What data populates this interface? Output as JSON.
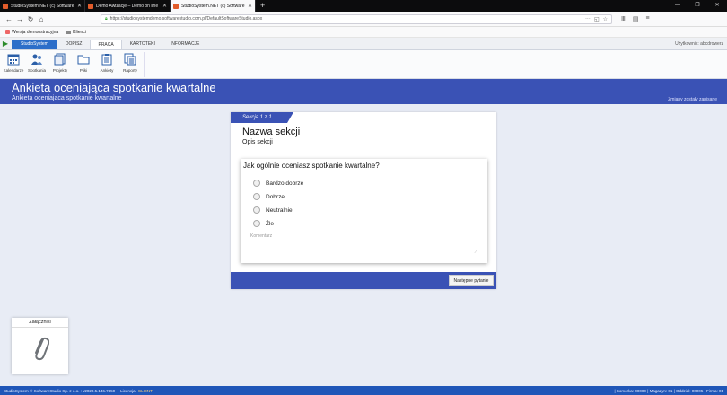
{
  "browser": {
    "tabs": [
      {
        "title": "StudioSystem.NET (c) Software",
        "color": "#e25c2b",
        "active": false
      },
      {
        "title": "Demo Awizacje – Demo on line",
        "color": "#e25c2b",
        "active": false
      },
      {
        "title": "StudioSystem.NET (c) Software",
        "color": "#e25c2b",
        "active": true
      }
    ],
    "new_tab": "+",
    "url": "https://studiosystemdemo.softwarestudio.com.pl/DefaultSoftwareStudio.aspx",
    "bookmarks": [
      {
        "label": "Wersja demonstracyjna",
        "type": "page"
      },
      {
        "label": "Klienci",
        "type": "folder"
      }
    ]
  },
  "app": {
    "tabs": [
      {
        "label": "StudioSystem",
        "kind": "brand"
      },
      {
        "label": "DOPISZ",
        "kind": "normal"
      },
      {
        "label": "PRACA",
        "kind": "active"
      },
      {
        "label": "KARTOTEKI",
        "kind": "normal"
      },
      {
        "label": "INFORMACJE",
        "kind": "normal"
      }
    ],
    "user": "Użytkownik: abcdrowerz",
    "tools": [
      {
        "label": "Kalendarze",
        "icon": "calendar-icon"
      },
      {
        "label": "Spotkania",
        "icon": "people-icon"
      },
      {
        "label": "Projekty",
        "icon": "projects-icon"
      },
      {
        "label": "Pliki",
        "icon": "folder-icon"
      },
      {
        "label": "Ankiety",
        "icon": "survey-icon"
      },
      {
        "label": "Raporty",
        "icon": "reports-icon"
      }
    ]
  },
  "banner": {
    "title": "Ankieta oceniająca spotkanie kwartalne",
    "subtitle": "Ankieta oceniająca spotkanie kwartalne",
    "saved": "Zmiany zostały zapisane"
  },
  "survey": {
    "section_tag": "Sekcja 1 z 1",
    "section_title": "Nazwa sekcji",
    "section_desc": "Opis sekcji",
    "question": "Jak ogólnie oceniasz spotkanie kwartalne?",
    "options": [
      "Bardzo dobrze",
      "Dobrze",
      "Neutralnie",
      "Źle"
    ],
    "comment_placeholder": "Komentarz",
    "next_button": "Następne pytanie"
  },
  "attachments": {
    "title": "Załączniki"
  },
  "status": {
    "left": "StudioSystem © SoftwareStudio Sp. z o.o. : v2020.5.146.7450",
    "license_label": "Licencja:",
    "license_value": "CLIENT",
    "right": "| Komórka: 00000 | Magazyn: 01 | Oddział: 00005 | Firma: 01"
  }
}
